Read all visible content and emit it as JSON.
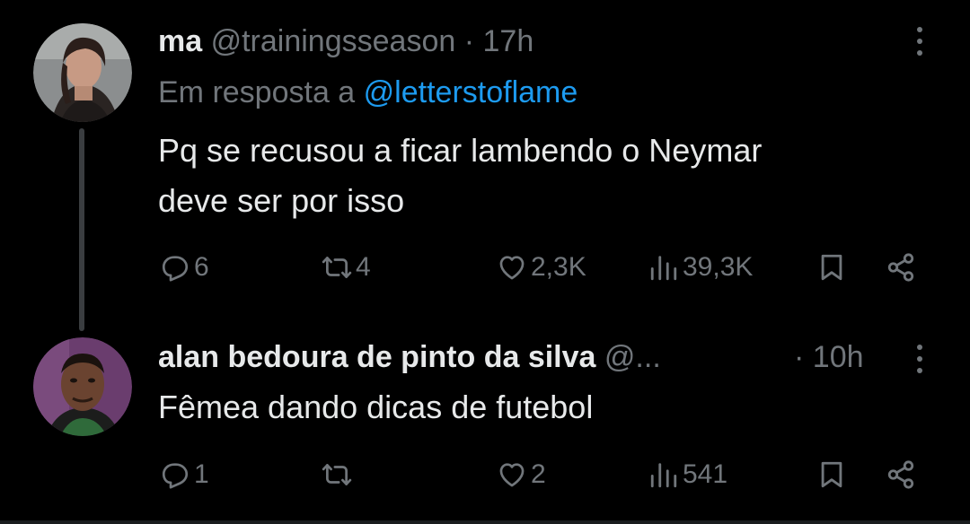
{
  "theme": {
    "background": "#000000",
    "text": "#e7e9ea",
    "muted": "#71767b",
    "link": "#1d9bf0"
  },
  "posts": [
    {
      "avatar_icon": "user-avatar-woman",
      "display_name": "ma",
      "handle": "@trainingsseason",
      "separator": "·",
      "time": "17h",
      "reply_to_prefix": "Em resposta a",
      "reply_to_handle": "@letterstoflame",
      "text_line1": "Pq se recusou a ficar lambendo o Neymar",
      "text_line2": "deve ser por isso",
      "stats": {
        "replies": "6",
        "reposts": "4",
        "likes": "2,3K",
        "views": "39,3K"
      },
      "icons": [
        "reply-icon",
        "repost-icon",
        "like-icon",
        "views-icon",
        "bookmark-icon",
        "share-icon",
        "more-options-icon"
      ]
    },
    {
      "avatar_icon": "user-avatar-man",
      "display_name": "alan bedoura de pinto da silva",
      "handle": "@...",
      "separator": "·",
      "time": "10h",
      "text_line1": "Fêmea dando dicas de futebol",
      "stats": {
        "replies": "1",
        "reposts": "",
        "likes": "2",
        "views": "541"
      },
      "icons": [
        "reply-icon",
        "repost-icon",
        "like-icon",
        "views-icon",
        "bookmark-icon",
        "share-icon",
        "more-options-icon"
      ]
    }
  ]
}
